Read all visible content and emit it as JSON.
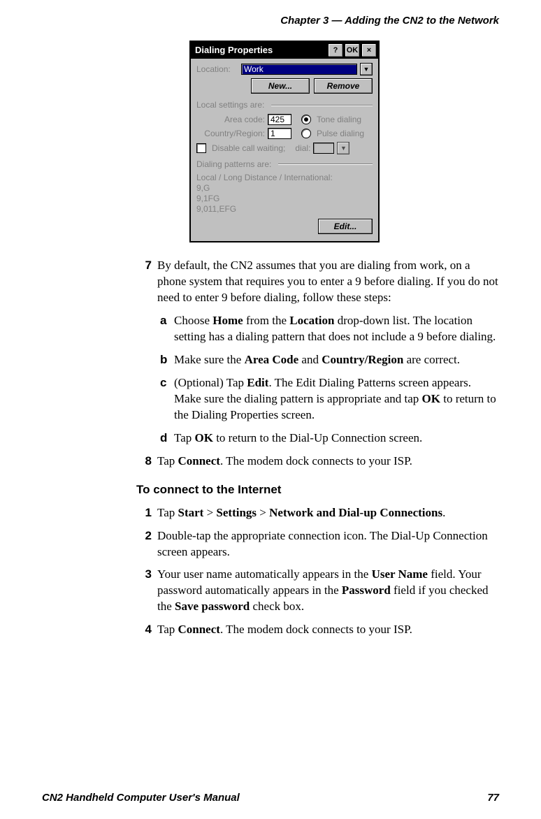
{
  "running_head": "Chapter 3 — Adding the CN2 to the Network",
  "dialog": {
    "title": "Dialing Properties",
    "help": "?",
    "ok": "OK",
    "close": "×",
    "location_label": "Location:",
    "location_value": "Work",
    "new_btn": "New...",
    "remove_btn": "Remove",
    "local_settings_label": "Local settings are:",
    "area_code_label": "Area code:",
    "area_code_value": "425",
    "country_label": "Country/Region:",
    "country_value": "1",
    "tone_label": "Tone dialing",
    "pulse_label": "Pulse dialing",
    "disable_label": "Disable call waiting;",
    "dial_label": "dial:",
    "patterns_label": "Dialing patterns are:",
    "patterns_sub": "Local / Long Distance / International:",
    "patterns_lines": [
      "9,G",
      "9,1FG",
      "9,011,EFG"
    ],
    "edit_btn": "Edit..."
  },
  "step7_num": "7",
  "step7_text": "By default, the CN2 assumes that you are dialing from work, on a phone system that requires you to enter a 9 before dialing. If you do not need to enter 9 before dialing, follow these steps:",
  "sub_a_num": "a",
  "sub_a_pre": "Choose ",
  "sub_a_b1": "Home",
  "sub_a_mid": " from the ",
  "sub_a_b2": "Location",
  "sub_a_post": " drop-down list. The location setting has a dialing pattern that does not include a 9 before dialing.",
  "sub_b_num": "b",
  "sub_b_pre": "Make sure the ",
  "sub_b_b1": "Area Code",
  "sub_b_mid": " and ",
  "sub_b_b2": "Country/Region",
  "sub_b_post": " are correct.",
  "sub_c_num": "c",
  "sub_c_pre": "(Optional) Tap ",
  "sub_c_b1": "Edit",
  "sub_c_mid": ". The Edit Dialing Patterns screen appears. Make sure the dialing pattern is appropriate and tap ",
  "sub_c_b2": "OK",
  "sub_c_post": " to return to the Dialing Properties screen.",
  "sub_d_num": "d",
  "sub_d_pre": "Tap ",
  "sub_d_b1": "OK",
  "sub_d_post": " to return to the Dial-Up Connection screen.",
  "step8_num": "8",
  "step8_pre": "Tap ",
  "step8_b1": "Connect",
  "step8_post": ". The modem dock connects to your ISP.",
  "heading2": "To connect to the Internet",
  "s1_num": "1",
  "s1_pre": "Tap ",
  "s1_b1": "Start",
  "s1_m1": " > ",
  "s1_b2": "Settings",
  "s1_m2": " > ",
  "s1_b3": "Network and Dial-up Connections",
  "s1_post": ".",
  "s2_num": "2",
  "s2_text": "Double-tap the appropriate connection icon. The Dial-Up Connection screen appears.",
  "s3_num": "3",
  "s3_pre": "Your user name automatically appears in the ",
  "s3_b1": "User Name",
  "s3_m1": " field. Your password automatically appears in the ",
  "s3_b2": "Password",
  "s3_m2": " field if you checked the ",
  "s3_b3": "Save password",
  "s3_post": " check box.",
  "s4_num": "4",
  "s4_pre": "Tap ",
  "s4_b1": "Connect",
  "s4_post": ". The modem dock connects to your ISP.",
  "footer_left": "CN2 Handheld Computer User's Manual",
  "footer_right": "77"
}
